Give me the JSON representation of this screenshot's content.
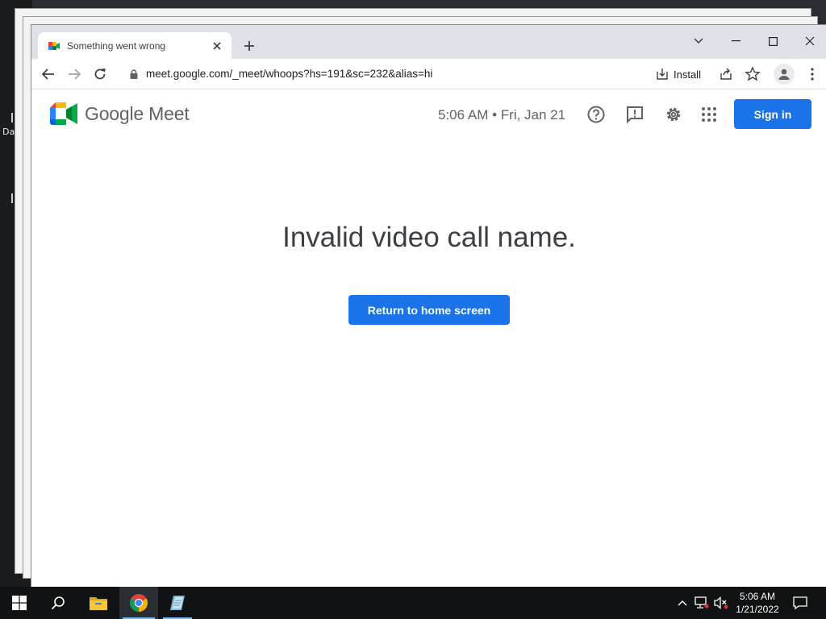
{
  "desktop": {
    "label": "Da"
  },
  "browser": {
    "tab": {
      "title": "Something went wrong"
    },
    "address": {
      "url": "meet.google.com/_meet/whoops?hs=191&sc=232&alias=hi"
    },
    "install_label": "Install"
  },
  "meet": {
    "brand_google": "Google",
    "brand_meet": "Meet",
    "datetime": "5:06 AM • Fri, Jan 21",
    "signin_label": "Sign in",
    "error_title": "Invalid video call name.",
    "return_label": "Return to home screen"
  },
  "colors": {
    "accent": "#1a73e8",
    "taskbar": "#101214"
  },
  "taskbar": {
    "items": [
      "start-icon",
      "search-icon",
      "file-explorer-icon",
      "chrome-icon",
      "notes-app-icon"
    ],
    "clock_time": "5:06 AM",
    "clock_date": "1/21/2022"
  }
}
